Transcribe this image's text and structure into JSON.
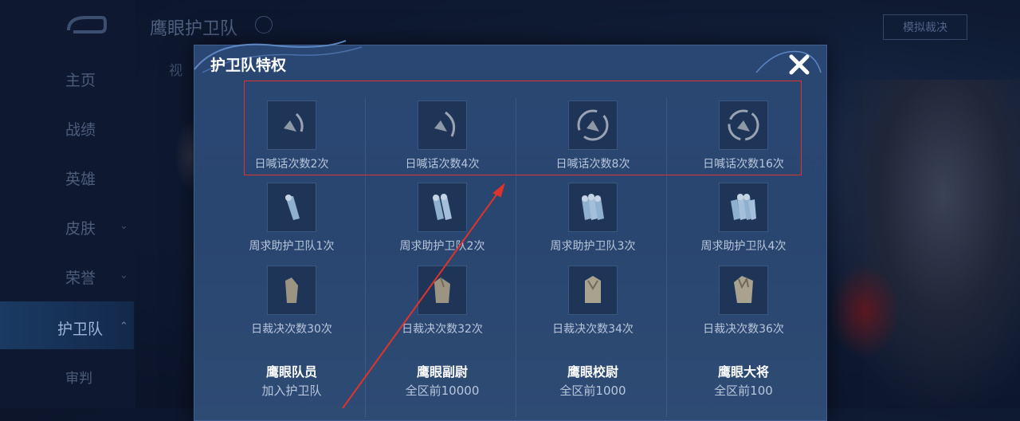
{
  "sidebar": {
    "items": [
      {
        "label": "主页"
      },
      {
        "label": "战绩"
      },
      {
        "label": "英雄"
      },
      {
        "label": "皮肤",
        "chevron": "⌄"
      },
      {
        "label": "荣誉",
        "chevron": "⌄"
      },
      {
        "label": "护卫队",
        "active": true,
        "chevron": "⌃"
      },
      {
        "label": "审判"
      }
    ]
  },
  "header": {
    "title": "鹰眼护卫队",
    "right_button": "模拟裁决",
    "tab_partial": "视"
  },
  "modal": {
    "title": "护卫队特权",
    "close_icon": "close-icon",
    "rows": [
      {
        "icon": "megaphone-icon",
        "cells": [
          "日喊话次数2次",
          "日喊话次数4次",
          "日喊话次数8次",
          "日喊话次数16次"
        ]
      },
      {
        "icon": "scroll-icon",
        "cells": [
          "周求助护卫队1次",
          "周求助护卫队2次",
          "周求助护卫队3次",
          "周求助护卫队4次"
        ]
      },
      {
        "icon": "gauntlet-icon",
        "cells": [
          "日裁决次数30次",
          "日裁决次数32次",
          "日裁决次数34次",
          "日裁决次数36次"
        ]
      }
    ],
    "ranks": [
      {
        "title": "鹰眼队员",
        "requirement": "加入护卫队"
      },
      {
        "title": "鹰眼副尉",
        "requirement": "全区前10000"
      },
      {
        "title": "鹰眼校尉",
        "requirement": "全区前1000"
      },
      {
        "title": "鹰眼大将",
        "requirement": "全区前100"
      }
    ]
  },
  "annotation": {
    "color": "#e0332b"
  }
}
